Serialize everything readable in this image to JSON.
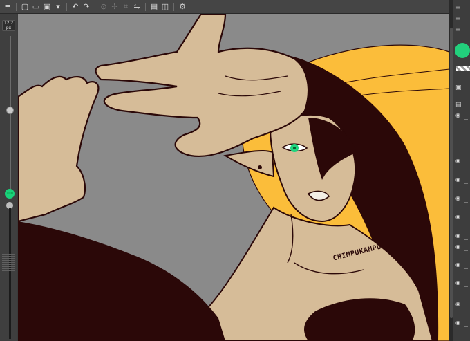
{
  "toolbar": {
    "buttons": [
      {
        "name": "menu-icon",
        "glyph": "≡"
      },
      {
        "name": "new-file-icon",
        "glyph": "▢"
      },
      {
        "name": "open-file-icon",
        "glyph": "▭"
      },
      {
        "name": "save-icon",
        "glyph": "▣"
      },
      {
        "name": "dropdown-icon",
        "glyph": "▾"
      },
      {
        "name": "undo-icon",
        "glyph": "↶"
      },
      {
        "name": "redo-icon",
        "glyph": "↷"
      },
      {
        "name": "select-icon",
        "glyph": "⊙"
      },
      {
        "name": "transform-icon",
        "glyph": "✢"
      },
      {
        "name": "crop-icon",
        "glyph": "⌗"
      },
      {
        "name": "flip-icon",
        "glyph": "⇋"
      },
      {
        "name": "fit-icon",
        "glyph": "▤"
      },
      {
        "name": "layer-icon",
        "glyph": "◫"
      },
      {
        "name": "settings-icon",
        "glyph": "⚙"
      }
    ]
  },
  "brush": {
    "size_value": "12.2",
    "size_unit": "px",
    "opacity_value": "100"
  },
  "canvas": {
    "watermark": "CHIMPUKAMPU",
    "background_color": "#8a8a8a",
    "skin_color": "#d6bc98",
    "line_color": "#2b0808",
    "hair_color": "#fbbd3a",
    "eye_color": "#1ed67e"
  },
  "right_panel": {
    "main_color": "#22d07c",
    "eye_icon": "👁"
  }
}
